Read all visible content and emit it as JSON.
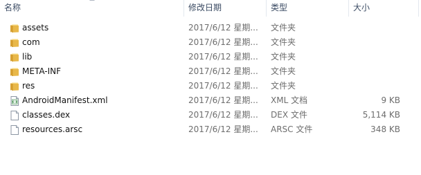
{
  "columns": {
    "name": "名称",
    "date": "修改日期",
    "type": "类型",
    "size": "大小"
  },
  "files": [
    {
      "name": "assets",
      "date": "2017/6/12 星期...",
      "type": "文件夹",
      "size": "",
      "icon": "folder-icon"
    },
    {
      "name": "com",
      "date": "2017/6/12 星期...",
      "type": "文件夹",
      "size": "",
      "icon": "folder-icon"
    },
    {
      "name": "lib",
      "date": "2017/6/12 星期...",
      "type": "文件夹",
      "size": "",
      "icon": "folder-icon"
    },
    {
      "name": "META-INF",
      "date": "2017/6/12 星期...",
      "type": "文件夹",
      "size": "",
      "icon": "folder-icon"
    },
    {
      "name": "res",
      "date": "2017/6/12 星期...",
      "type": "文件夹",
      "size": "",
      "icon": "folder-icon"
    },
    {
      "name": "AndroidManifest.xml",
      "date": "2017/6/12 星期...",
      "type": "XML 文档",
      "size": "9 KB",
      "icon": "xml-document-icon"
    },
    {
      "name": "classes.dex",
      "date": "2017/6/12 星期...",
      "type": "DEX 文件",
      "size": "5,114 KB",
      "icon": "file-icon"
    },
    {
      "name": "resources.arsc",
      "date": "2017/6/12 星期...",
      "type": "ARSC 文件",
      "size": "348 KB",
      "icon": "file-icon"
    }
  ],
  "colors": {
    "folder": "#e8b84a",
    "header_text": "#3b4b63",
    "secondary_text": "#6d6d6d"
  }
}
